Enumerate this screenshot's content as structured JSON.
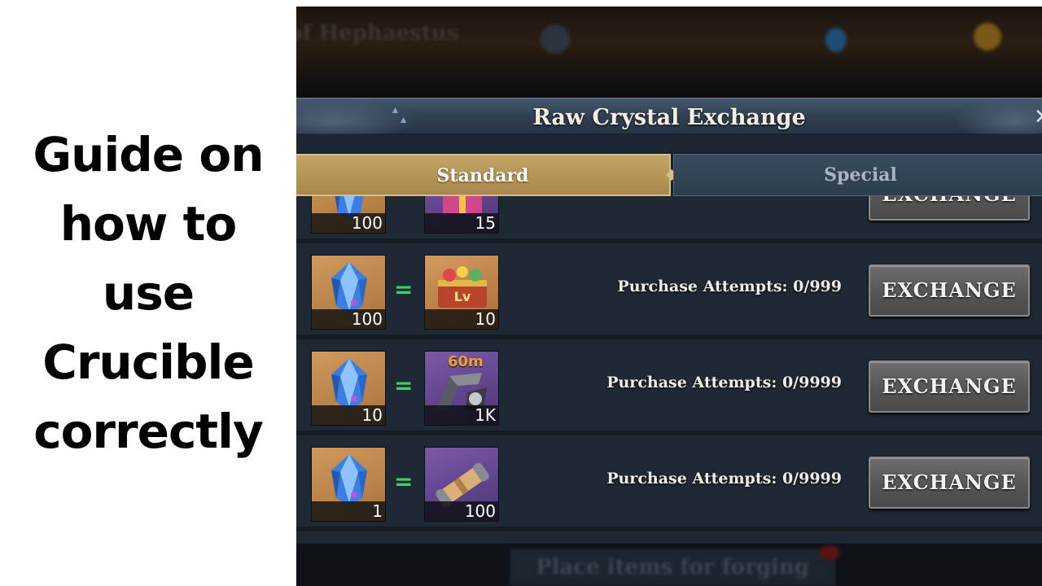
{
  "guide": {
    "title_lines": [
      "Guide on",
      "how to",
      "use",
      "Crucible",
      "correctly"
    ]
  },
  "background": {
    "top_text": "of Hephaestus",
    "bottom_button": "Place items for forging"
  },
  "dialog": {
    "title": "Raw Crystal Exchange",
    "close_icon": "close-icon",
    "tabs": [
      {
        "label": "Standard",
        "active": true
      },
      {
        "label": "Special",
        "active": false
      }
    ],
    "rows": [
      {
        "cost_icon": "raw-crystal-icon",
        "cost_qty": "100",
        "reward_icon": "gift-bundle-icon",
        "reward_qty": "15",
        "attempts": "",
        "button": "EXCHANGE"
      },
      {
        "cost_icon": "raw-crystal-icon",
        "cost_qty": "100",
        "reward_icon": "level-chest-icon",
        "reward_qty": "10",
        "attempts": "Purchase Attempts: 0/999",
        "button": "EXCHANGE"
      },
      {
        "cost_icon": "raw-crystal-icon",
        "cost_qty": "10",
        "reward_icon": "speedup-60m-icon",
        "reward_label": "60m",
        "reward_qty": "1K",
        "attempts": "Purchase Attempts: 0/9999",
        "button": "EXCHANGE"
      },
      {
        "cost_icon": "raw-crystal-icon",
        "cost_qty": "1",
        "reward_icon": "scroll-icon",
        "reward_qty": "100",
        "attempts": "Purchase Attempts: 0/9999",
        "button": "EXCHANGE"
      }
    ],
    "equals_sign": "="
  },
  "colors": {
    "tab_active": "#b8995a",
    "equals": "#3fcf6a",
    "dialog_bg": "#1d2733"
  }
}
